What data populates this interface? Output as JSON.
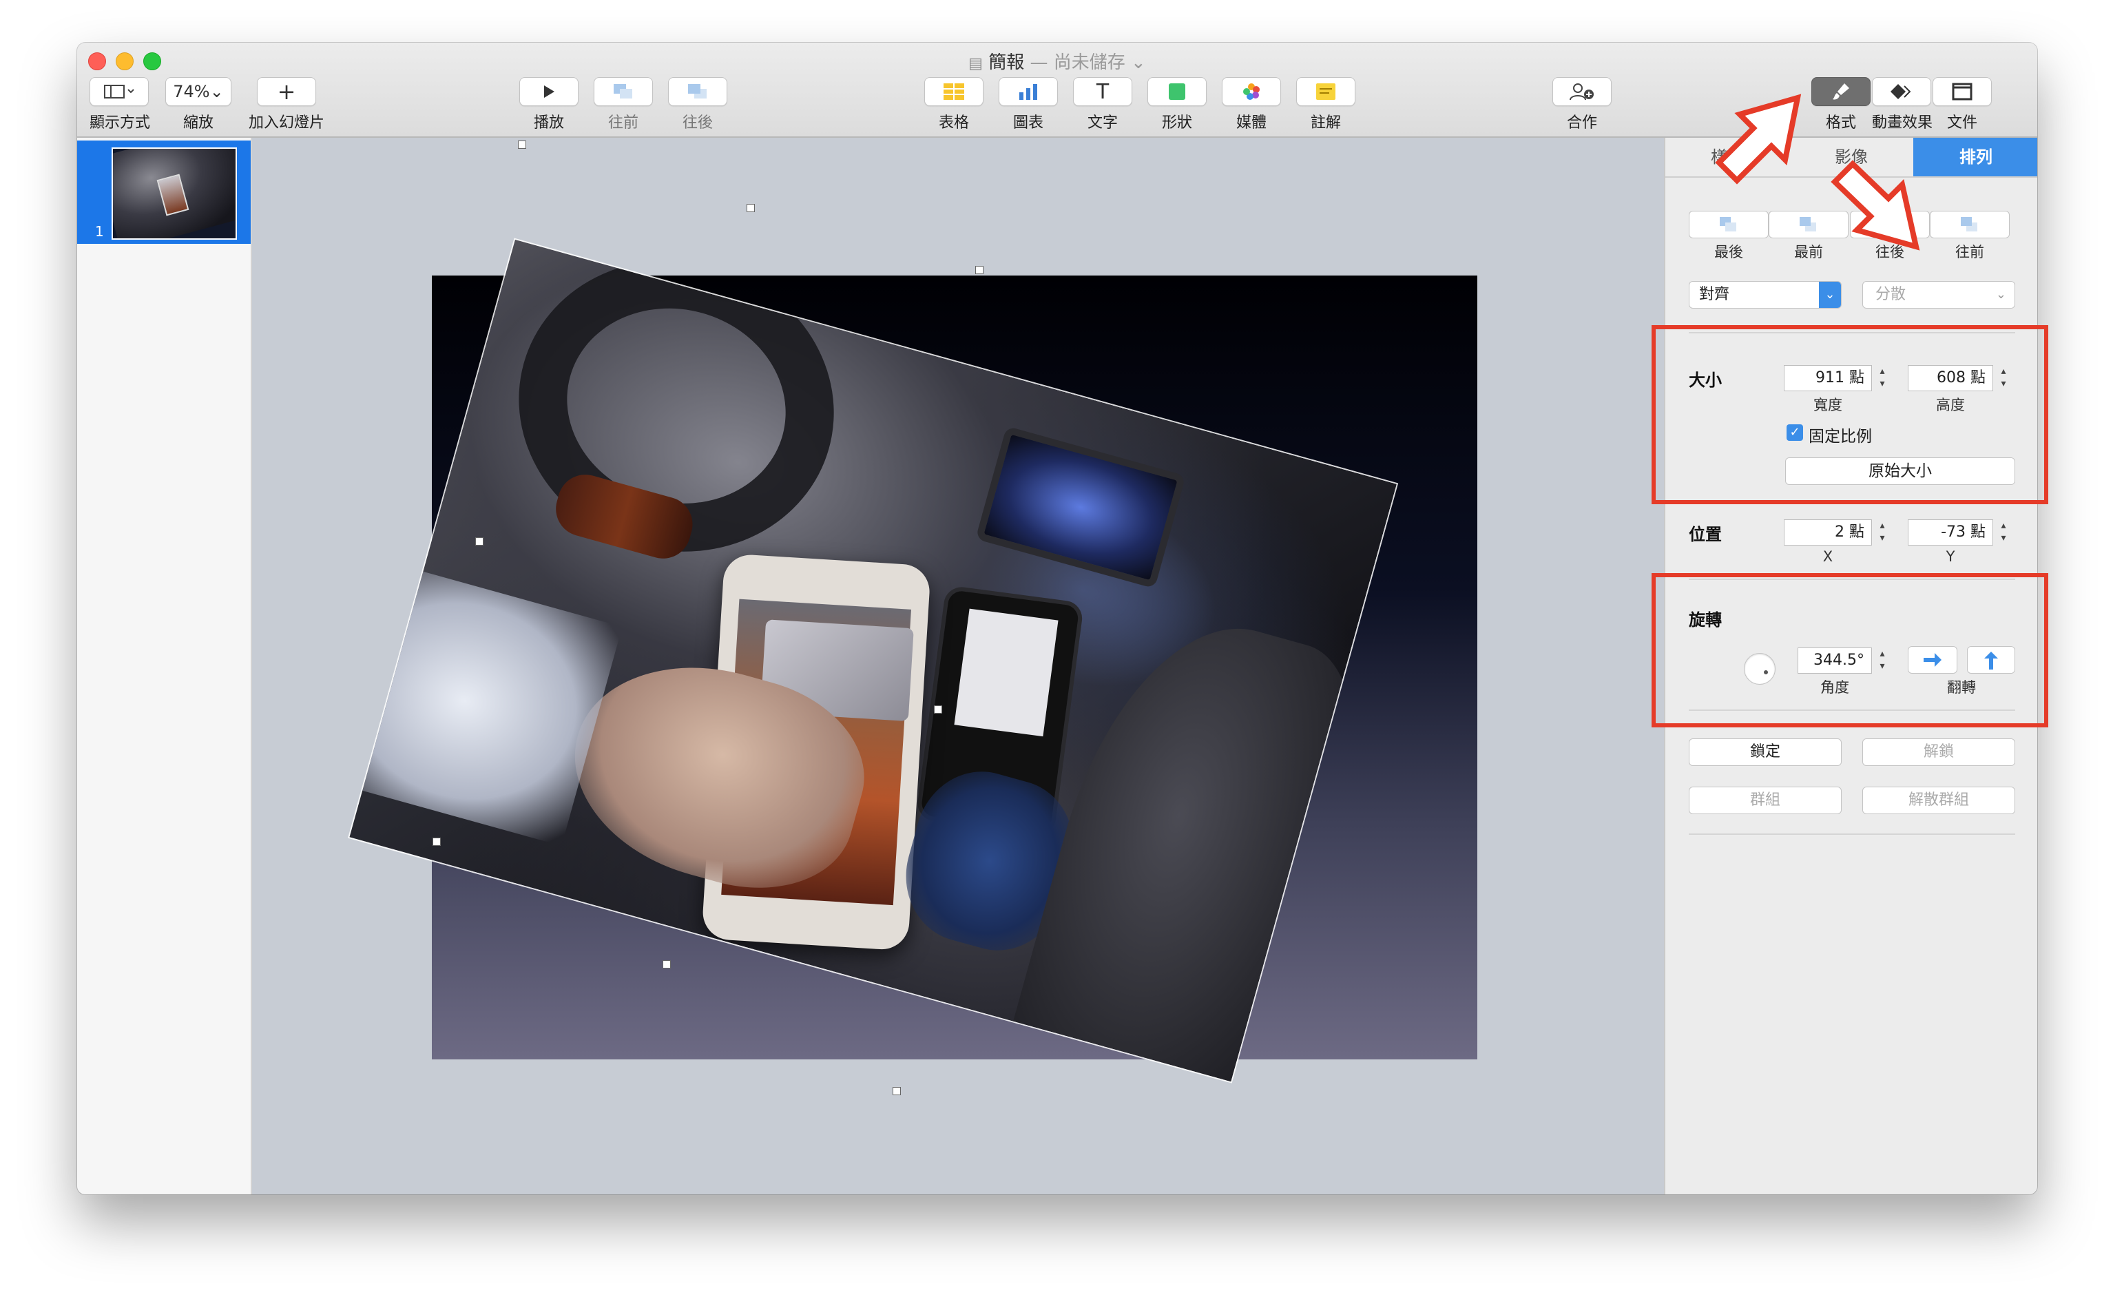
{
  "window": {
    "title": "簡報",
    "subtitle": "— 尚未儲存 ⌄"
  },
  "toolbar": {
    "view_label": "顯示方式",
    "zoom_value": "74%⌄",
    "zoom_label": "縮放",
    "add_slide_label": "加入幻燈片",
    "play_label": "播放",
    "backward_label": "往前",
    "forward_label": "往後",
    "table_label": "表格",
    "chart_label": "圖表",
    "text_label": "文字",
    "shape_label": "形狀",
    "media_label": "媒體",
    "comment_label": "註解",
    "collaborate_label": "合作",
    "format_label": "格式",
    "animate_label": "動畫效果",
    "document_label": "文件"
  },
  "navigator": {
    "slide_number": "1"
  },
  "inspector": {
    "tabs": [
      "樣式",
      "影像",
      "排列"
    ],
    "arrange_buttons": [
      "最後",
      "最前",
      "往後",
      "往前"
    ],
    "align_label": "對齊",
    "distribute_label": "分散",
    "size": {
      "label": "大小",
      "width_value": "911 點",
      "width_label": "寬度",
      "height_value": "608 點",
      "height_label": "高度",
      "constrain_label": "固定比例",
      "original_size_label": "原始大小"
    },
    "position": {
      "label": "位置",
      "x_value": "2 點",
      "x_label": "X",
      "y_value": "-73 點",
      "y_label": "Y"
    },
    "rotate": {
      "label": "旋轉",
      "angle_value": "344.5°",
      "angle_label": "角度",
      "flip_label": "翻轉"
    },
    "lock_label": "鎖定",
    "unlock_label": "解鎖",
    "group_label": "群組",
    "ungroup_label": "解散群組"
  },
  "colors": {
    "accent": "#1c77e8",
    "tab_active": "#3b8ee8",
    "annotation": "#e53b28"
  }
}
